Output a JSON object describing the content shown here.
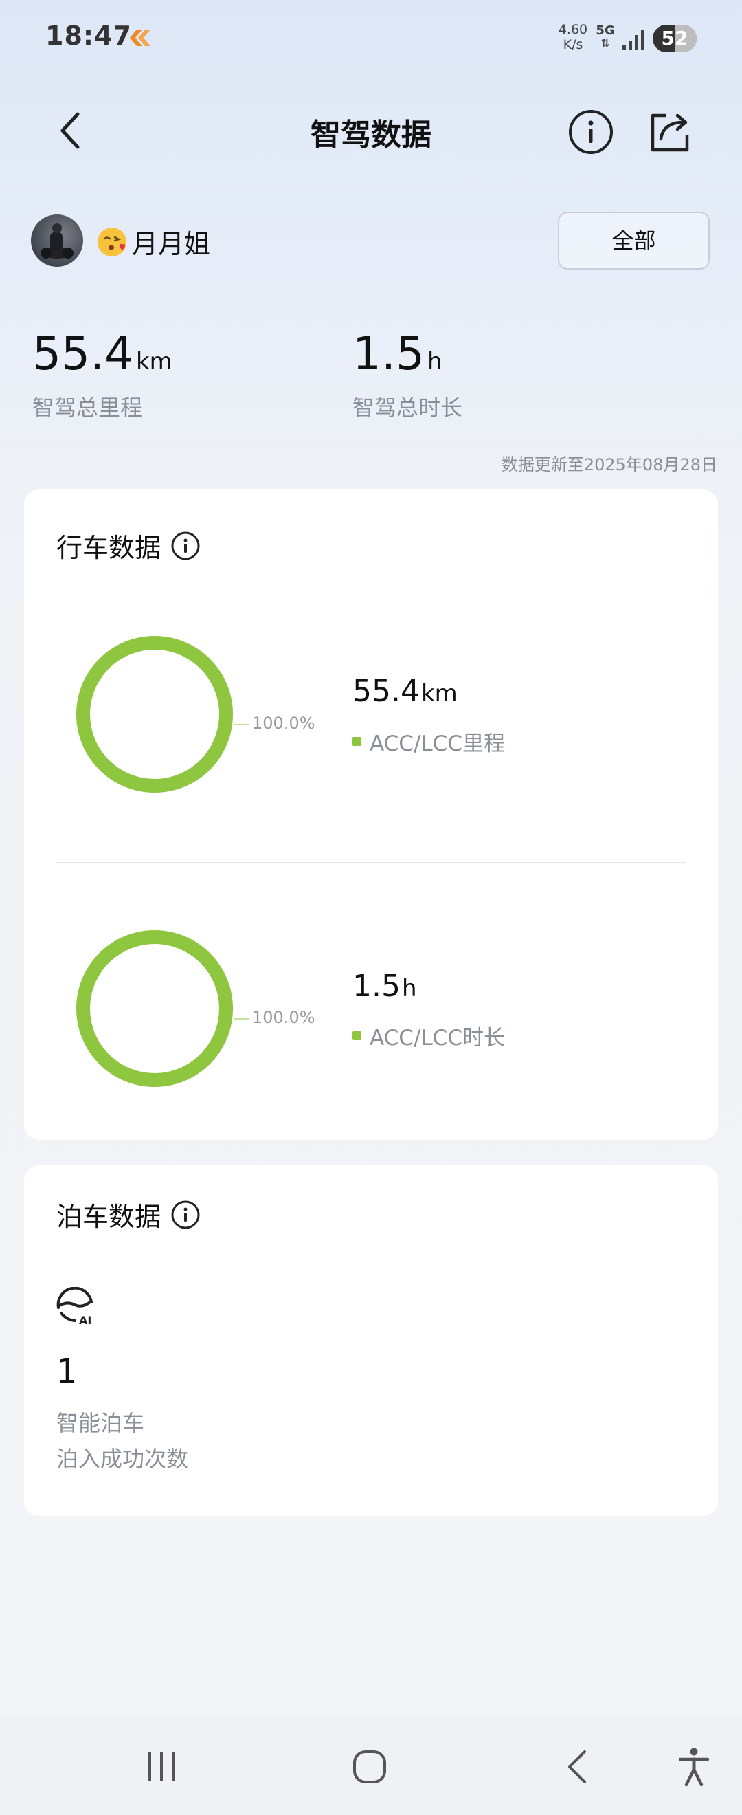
{
  "status_bar": {
    "time": "18:47",
    "net_speed_value": "4.60",
    "net_speed_unit": "K/s",
    "network": "5G",
    "battery": "52",
    "battery_level": 0.52
  },
  "header": {
    "title": "智驾数据"
  },
  "user": {
    "name": "月月姐",
    "filter_label": "全部"
  },
  "totals": [
    {
      "value": "55.4",
      "unit": "km",
      "label": "智驾总里程"
    },
    {
      "value": "1.5",
      "unit": "h",
      "label": "智驾总时长"
    }
  ],
  "update_text": "数据更新至2025年08月28日",
  "driving": {
    "title": "行车数据",
    "metrics": [
      {
        "value": "55.4",
        "unit": "km",
        "label": "ACC/LCC里程",
        "percent": "100.0%",
        "fraction": 1.0
      },
      {
        "value": "1.5",
        "unit": "h",
        "label": "ACC/LCC时长",
        "percent": "100.0%",
        "fraction": 1.0
      }
    ]
  },
  "parking": {
    "title": "泊车数据",
    "count": "1",
    "label1": "智能泊车",
    "label2": "泊入成功次数"
  },
  "colors": {
    "accent": "#8ec63f",
    "ring": "#8ec63f",
    "text_secondary": "#8a8f97"
  },
  "icons": [
    "back-arrow-icon",
    "info-icon",
    "share-icon",
    "parking-ai-icon",
    "recent-apps-icon",
    "home-icon",
    "back-icon",
    "accessibility-icon"
  ]
}
